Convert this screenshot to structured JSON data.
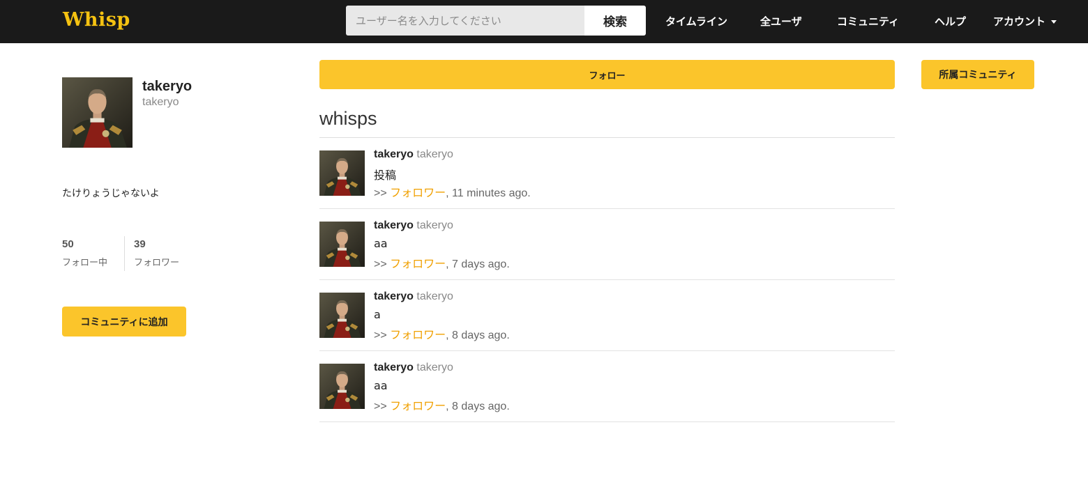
{
  "brand": "Whisp",
  "search": {
    "placeholder": "ユーザー名を入力してください",
    "button_label": "検索"
  },
  "nav": {
    "timeline": "タイムライン",
    "all_users": "全ユーザ",
    "community": "コミュニティ",
    "help": "ヘルプ",
    "account": "アカウント"
  },
  "profile": {
    "name": "takeryo",
    "handle": "takeryo",
    "bio": "たけりょうじゃないよ",
    "following_count": "50",
    "following_label": "フォロー中",
    "followers_count": "39",
    "followers_label": "フォロワー",
    "add_community_label": "コミュニティに追加"
  },
  "actions": {
    "follow_label": "フォロー",
    "communities_label": "所属コミュニティ"
  },
  "feed": {
    "title": "whisps",
    "posts": [
      {
        "author": "takeryo",
        "handle": "takeryo",
        "body": "投稿",
        "prefix": ">> ",
        "link": "フォロワー",
        "time": ", 11 minutes ago."
      },
      {
        "author": "takeryo",
        "handle": "takeryo",
        "body": "aa",
        "prefix": ">> ",
        "link": "フォロワー",
        "time": ", 7 days ago."
      },
      {
        "author": "takeryo",
        "handle": "takeryo",
        "body": "a",
        "prefix": ">> ",
        "link": "フォロワー",
        "time": ", 8 days ago."
      },
      {
        "author": "takeryo",
        "handle": "takeryo",
        "body": "aa",
        "prefix": ">> ",
        "link": "フォロワー",
        "time": ", 8 days ago."
      }
    ]
  },
  "colors": {
    "navbar": "#1a1a1a",
    "brand": "#f5c211",
    "accent_button": "#fbc52b",
    "link": "#f0a000"
  },
  "icons": {
    "avatar": "portrait-avatar-image",
    "account_caret": "caret-down-icon"
  }
}
